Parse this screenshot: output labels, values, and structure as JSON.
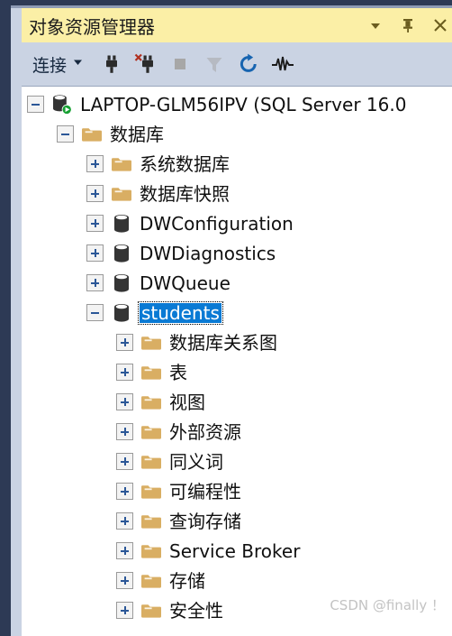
{
  "window": {
    "title": "对象资源管理器",
    "title_bar_color": "#fbefa6",
    "toolbar_color": "#cad3e3",
    "frame_color": "#2d3a55",
    "selection_color": "#0a7ad4",
    "folder_color": "#d9ae63",
    "controls": [
      {
        "name": "window-menu-dropdown",
        "icon": "chevron-down-icon"
      },
      {
        "name": "pin-window",
        "icon": "pin-icon"
      },
      {
        "name": "close-window",
        "icon": "close-icon"
      }
    ]
  },
  "toolbar": {
    "connect_label": "连接",
    "buttons": [
      {
        "name": "connect-dropdown",
        "icon": "chevron-down-icon",
        "label": "连接"
      },
      {
        "name": "connect-object-explorer",
        "icon": "plug-connect-icon",
        "label": ""
      },
      {
        "name": "disconnect-object-explorer",
        "icon": "plug-disconnect-icon",
        "label": ""
      },
      {
        "name": "stop",
        "icon": "stop-square-icon",
        "label": ""
      },
      {
        "name": "filter",
        "icon": "funnel-filter-icon",
        "label": ""
      },
      {
        "name": "refresh",
        "icon": "refresh-circular-arrow-icon",
        "label": ""
      },
      {
        "name": "activity-monitor",
        "icon": "waveform-activity-icon",
        "label": ""
      }
    ]
  },
  "tree": {
    "nodes": [
      {
        "label": "LAPTOP-GLM56IPV (SQL Server 16.0",
        "depth": 0,
        "icon": "server-running-icon",
        "state": "expanded",
        "selected": false
      },
      {
        "label": "数据库",
        "depth": 1,
        "icon": "folder-icon",
        "state": "expanded",
        "selected": false
      },
      {
        "label": "系统数据库",
        "depth": 2,
        "icon": "folder-icon",
        "state": "collapsed",
        "selected": false
      },
      {
        "label": "数据库快照",
        "depth": 2,
        "icon": "folder-icon",
        "state": "collapsed",
        "selected": false
      },
      {
        "label": "DWConfiguration",
        "depth": 2,
        "icon": "database-icon",
        "state": "collapsed",
        "selected": false
      },
      {
        "label": "DWDiagnostics",
        "depth": 2,
        "icon": "database-icon",
        "state": "collapsed",
        "selected": false
      },
      {
        "label": "DWQueue",
        "depth": 2,
        "icon": "database-icon",
        "state": "collapsed",
        "selected": false
      },
      {
        "label": "students",
        "depth": 2,
        "icon": "database-icon",
        "state": "expanded",
        "selected": true
      },
      {
        "label": "数据库关系图",
        "depth": 3,
        "icon": "folder-icon",
        "state": "collapsed",
        "selected": false
      },
      {
        "label": "表",
        "depth": 3,
        "icon": "folder-icon",
        "state": "collapsed",
        "selected": false
      },
      {
        "label": "视图",
        "depth": 3,
        "icon": "folder-icon",
        "state": "collapsed",
        "selected": false
      },
      {
        "label": "外部资源",
        "depth": 3,
        "icon": "folder-icon",
        "state": "collapsed",
        "selected": false
      },
      {
        "label": "同义词",
        "depth": 3,
        "icon": "folder-icon",
        "state": "collapsed",
        "selected": false
      },
      {
        "label": "可编程性",
        "depth": 3,
        "icon": "folder-icon",
        "state": "collapsed",
        "selected": false
      },
      {
        "label": "查询存储",
        "depth": 3,
        "icon": "folder-icon",
        "state": "collapsed",
        "selected": false
      },
      {
        "label": "Service Broker",
        "depth": 3,
        "icon": "folder-icon",
        "state": "collapsed",
        "selected": false
      },
      {
        "label": "存储",
        "depth": 3,
        "icon": "folder-icon",
        "state": "collapsed",
        "selected": false
      },
      {
        "label": "安全性",
        "depth": 3,
        "icon": "folder-icon",
        "state": "collapsed",
        "selected": false
      }
    ]
  },
  "watermark": "CSDN @finally ！"
}
